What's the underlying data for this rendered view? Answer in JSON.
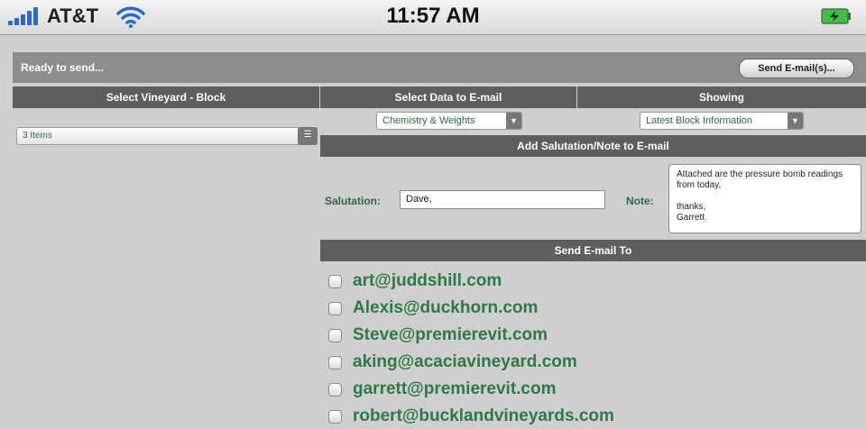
{
  "status_bar": {
    "carrier": "AT&T",
    "time": "11:57 AM"
  },
  "toolbar": {
    "status_text": "Ready to send...",
    "send_button": "Send E-mail(s)..."
  },
  "columns": {
    "vineyard_header": "Select Vineyard - Block",
    "data_header": "Select Data to E-mail",
    "showing_header": "Showing"
  },
  "vineyard": {
    "selected": "3 Items"
  },
  "data_select": {
    "value": "Chemistry & Weights"
  },
  "showing_select": {
    "value": "Latest Block Information"
  },
  "salutation_section": {
    "header": "Add Salutation/Note to E-mail",
    "salutation_label": "Salutation:",
    "salutation_value": "Dave,",
    "note_label": "Note:",
    "note_value": "Attached are the pressure bomb readings from today,\n\nthanks,\nGarrett"
  },
  "send_to": {
    "header": "Send E-mail To",
    "emails": [
      "art@juddshill.com",
      "Alexis@duckhorn.com",
      "Steve@premierevit.com",
      "aking@acaciavineyard.com",
      "garrett@premierevit.com",
      "robert@bucklandvineyards.com"
    ]
  },
  "colors": {
    "header_bg": "#5e5e5e",
    "toolbar_bg": "#8d8d8d",
    "panel_bg": "#cfcfcf",
    "accent_green": "#2e7a45"
  }
}
